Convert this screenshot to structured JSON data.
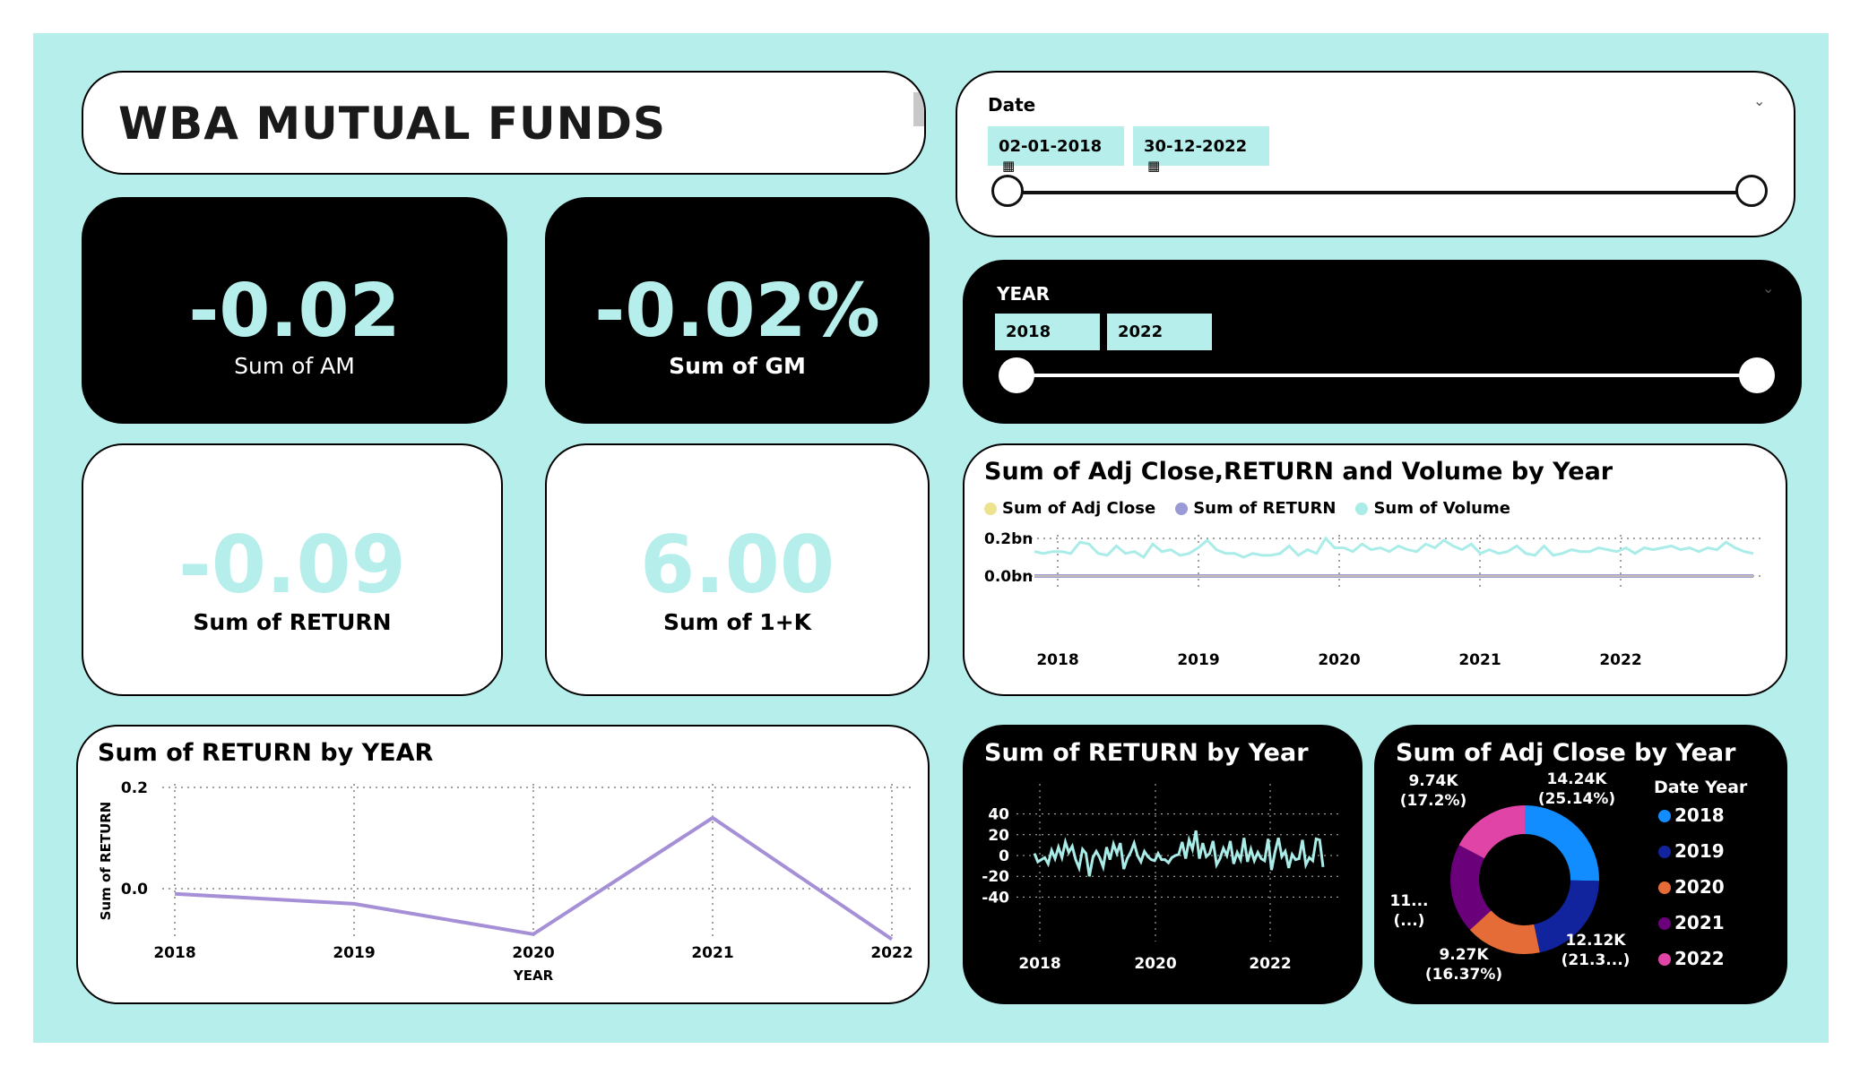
{
  "header": {
    "title": "WBA MUTUAL FUNDS"
  },
  "kpis": {
    "am": {
      "value": "-0.02",
      "label": "Sum of AM"
    },
    "gm": {
      "value": "-0.02%",
      "label": "Sum of GM"
    },
    "return": {
      "value": "-0.09",
      "label": "Sum of RETURN"
    },
    "onek": {
      "value": "6.00",
      "label": "Sum of 1+K"
    }
  },
  "date_slicer": {
    "label": "Date",
    "start": "02-01-2018",
    "end": "30-12-2022"
  },
  "year_slicer": {
    "label": "YEAR",
    "start": "2018",
    "end": "2022"
  },
  "colors": {
    "accent": "#b6eeeb",
    "purple": "#a58fd6",
    "teal": "#a9ece8"
  },
  "chart_data": [
    {
      "type": "line",
      "title": "Sum of Adj Close,RETURN and Volume by Year",
      "legend": [
        "Sum of Adj Close",
        "Sum of RETURN",
        "Sum of Volume"
      ],
      "legend_colors": [
        "#ede38e",
        "#9a9ad6",
        "#a9ece8"
      ],
      "ytick_labels": [
        "0.2bn",
        "0.0bn"
      ],
      "xtick_labels": [
        "2018",
        "2019",
        "2020",
        "2021",
        "2022"
      ],
      "ylim": [
        0,
        0.22
      ],
      "series": [
        {
          "name": "Sum of Volume",
          "values": [
            0.13,
            0.12,
            0.13,
            0.13,
            0.12,
            0.18,
            0.17,
            0.12,
            0.11,
            0.16,
            0.12,
            0.13,
            0.1,
            0.17,
            0.13,
            0.14,
            0.11,
            0.12,
            0.15,
            0.19,
            0.14,
            0.12,
            0.12,
            0.1,
            0.12,
            0.11,
            0.11,
            0.12,
            0.16,
            0.11,
            0.14,
            0.12,
            0.2,
            0.15,
            0.15,
            0.13,
            0.17,
            0.14,
            0.15,
            0.13,
            0.16,
            0.14,
            0.13,
            0.17,
            0.15,
            0.19,
            0.16,
            0.14,
            0.17,
            0.12,
            0.14,
            0.12,
            0.13,
            0.16,
            0.12,
            0.11,
            0.16,
            0.11,
            0.12,
            0.14,
            0.13,
            0.13,
            0.15,
            0.14,
            0.13,
            0.15,
            0.12,
            0.15,
            0.14,
            0.15,
            0.16,
            0.14,
            0.15,
            0.13,
            0.15,
            0.14,
            0.18,
            0.15,
            0.13,
            0.12
          ]
        },
        {
          "name": "Sum of RETURN",
          "values": [
            0,
            0,
            0,
            0,
            0,
            0,
            0,
            0,
            0,
            0,
            0,
            0,
            0,
            0,
            0,
            0,
            0,
            0,
            0,
            0,
            0,
            0,
            0,
            0,
            0,
            0,
            0,
            0,
            0,
            0,
            0,
            0,
            0,
            0,
            0,
            0,
            0,
            0,
            0,
            0,
            0,
            0,
            0,
            0,
            0,
            0,
            0,
            0,
            0,
            0,
            0,
            0,
            0,
            0,
            0,
            0,
            0,
            0,
            0,
            0
          ]
        },
        {
          "name": "Sum of Adj Close",
          "values": [
            0,
            0,
            0,
            0,
            0,
            0,
            0,
            0,
            0,
            0
          ]
        }
      ]
    },
    {
      "type": "line",
      "title": "Sum of RETURN by YEAR",
      "categories": [
        "2018",
        "2019",
        "2020",
        "2021",
        "2022"
      ],
      "xlabel": "YEAR",
      "ylabel": "Sum of RETURN",
      "ytick_labels": [
        "0.2",
        "0.0"
      ],
      "ylim": [
        -0.1,
        0.2
      ],
      "series": [
        {
          "name": "Sum of RETURN",
          "values": [
            -0.01,
            -0.03,
            -0.09,
            0.14,
            -0.1
          ]
        }
      ]
    },
    {
      "type": "line",
      "title": "Sum of RETURN by Year",
      "ytick_labels": [
        "40",
        "20",
        "0",
        "-20",
        "-40"
      ],
      "xtick_labels": [
        "2018",
        "2020",
        "2022"
      ],
      "ylim": [
        -40,
        40
      ],
      "series": [
        {
          "name": "Sum of RETURN",
          "values": [
            2,
            -6,
            -4,
            -2,
            -8,
            5,
            -3,
            8,
            -2,
            13,
            3,
            9,
            -4,
            -12,
            6,
            2,
            -20,
            -2,
            4,
            -2,
            -11,
            8,
            -4,
            11,
            2,
            12,
            -13,
            -3,
            3,
            12,
            0,
            -6,
            4,
            -1,
            -4,
            -5,
            2,
            -4,
            -4,
            -7,
            -2,
            0,
            1,
            13,
            -3,
            15,
            6,
            24,
            -3,
            12,
            -1,
            2,
            14,
            -9,
            -3,
            7,
            0,
            14,
            -8,
            3,
            -4,
            17,
            -6,
            6,
            -5,
            3,
            -3,
            -5,
            16,
            -14,
            3,
            17,
            -1,
            4,
            -12,
            1,
            -4,
            -3,
            15,
            -9,
            -2,
            -5,
            16,
            15,
            -11
          ]
        }
      ]
    },
    {
      "type": "pie",
      "title": "Sum of Adj Close by Year",
      "legend_title": "Date Year",
      "categories": [
        "2018",
        "2019",
        "2020",
        "2021",
        "2022"
      ],
      "values": [
        14.24,
        12.12,
        9.27,
        11.0,
        9.74
      ],
      "colors": [
        "#118dff",
        "#12239e",
        "#e66c37",
        "#6b007b",
        "#e044a7"
      ],
      "labels": [
        {
          "value": "14.24K",
          "pct": "(25.14%)"
        },
        {
          "value": "12.12K",
          "pct": "(21.3...)"
        },
        {
          "value": "9.27K",
          "pct": "(16.37%)"
        },
        {
          "value": "11...",
          "pct": "(...)"
        },
        {
          "value": "9.74K",
          "pct": "(17.2%)"
        }
      ]
    }
  ]
}
